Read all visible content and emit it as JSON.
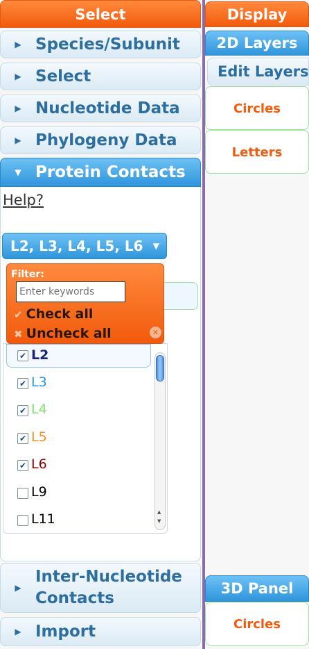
{
  "left_panel": {
    "header": "Select",
    "sections": [
      {
        "label": "Species/Subunit"
      },
      {
        "label": "Select"
      },
      {
        "label": "Nucleotide Data"
      },
      {
        "label": "Phylogeny Data"
      },
      {
        "label": "Protein Contacts"
      }
    ],
    "help_link": "Help?",
    "multiselect": {
      "button_label": "L2, L3, L4, L5, L6",
      "filter_label": "Filter:",
      "filter_placeholder": "Enter keywords",
      "check_all": "Check all",
      "uncheck_all": "Uncheck all",
      "options": [
        {
          "label": "L2",
          "checked": true,
          "color": "#1a237e"
        },
        {
          "label": "L3",
          "checked": true,
          "color": "#2196f3"
        },
        {
          "label": "L4",
          "checked": true,
          "color": "#7ee26a"
        },
        {
          "label": "L5",
          "checked": true,
          "color": "#ff8c1a"
        },
        {
          "label": "L6",
          "checked": true,
          "color": "#8b0000"
        },
        {
          "label": "L9",
          "checked": false,
          "color": "#000000"
        },
        {
          "label": "L11",
          "checked": false,
          "color": "#000000"
        }
      ]
    },
    "bottom_sections": [
      {
        "label_line1": "Inter-Nucleotide",
        "label_line2": "Contacts"
      },
      {
        "label": "Import"
      }
    ]
  },
  "right_panel": {
    "header": "Display",
    "layers_2d_button": "2D Layers",
    "edit_layers_label": "Edit Layers",
    "layers_2d": [
      "Circles",
      "Letters"
    ],
    "panel_3d_button": "3D Panel",
    "layers_3d": [
      "Circles"
    ]
  },
  "colors": {
    "accent_orange": "#f25a0c",
    "accent_blue": "#2f95da",
    "header_text_blue": "#2e6e9e",
    "green_border": "#9ae39a"
  }
}
